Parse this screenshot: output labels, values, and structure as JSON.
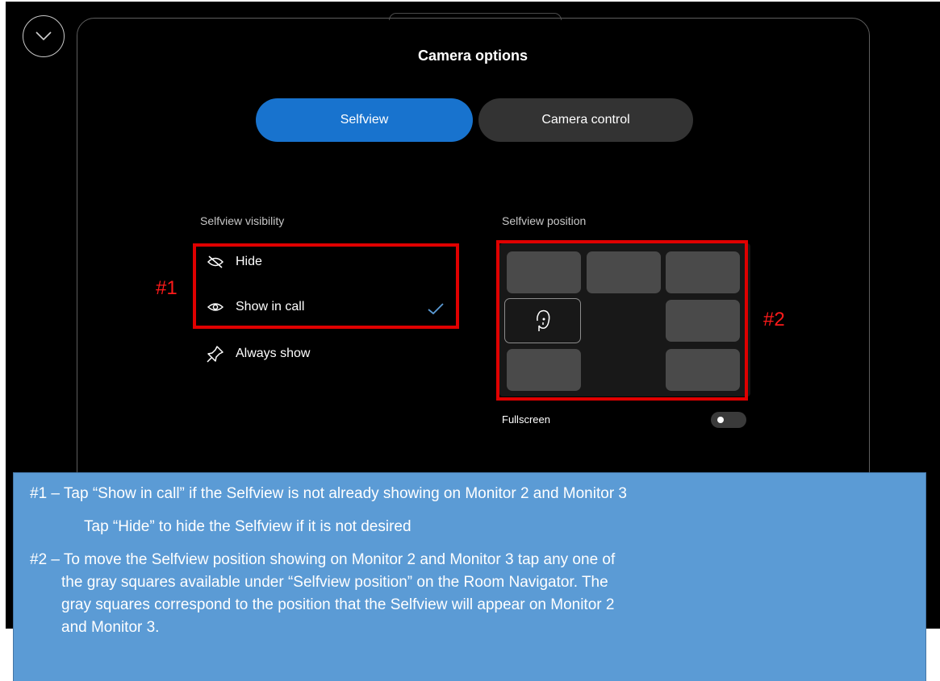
{
  "dialog": {
    "title": "Camera options",
    "tabs": [
      {
        "label": "Selfview",
        "selected": true
      },
      {
        "label": "Camera control",
        "selected": false
      }
    ]
  },
  "visibility": {
    "label": "Selfview visibility",
    "options": [
      {
        "label": "Hide",
        "icon": "eye-slash-icon"
      },
      {
        "label": "Show in call",
        "icon": "eye-icon",
        "checked": true
      },
      {
        "label": "Always show",
        "icon": "pin-icon"
      }
    ]
  },
  "position": {
    "label": "Selfview position",
    "selected_cell": "middle-left",
    "fullscreen_label": "Fullscreen",
    "fullscreen_on": false
  },
  "annotations": {
    "marker1": "#1",
    "marker2": "#2",
    "highlight_color": "#e00000"
  },
  "note": {
    "line1": "#1 – Tap “Show in call” if the Selfview is not already showing on Monitor 2 and Monitor 3",
    "line2": "Tap “Hide” to hide the Selfview if it is not desired",
    "line3": "#2 – To move the Selfview position showing on Monitor 2 and Monitor 3 tap any one of",
    "line4": "the gray squares available under “Selfview position” on the Room Navigator.  The",
    "line5": "gray squares correspond to the position that the Selfview will appear on Monitor 2",
    "line6": "and Monitor 3.",
    "background": "#5b9bd5"
  },
  "colors": {
    "accent": "#1873ce",
    "check": "#5b9bd5"
  }
}
